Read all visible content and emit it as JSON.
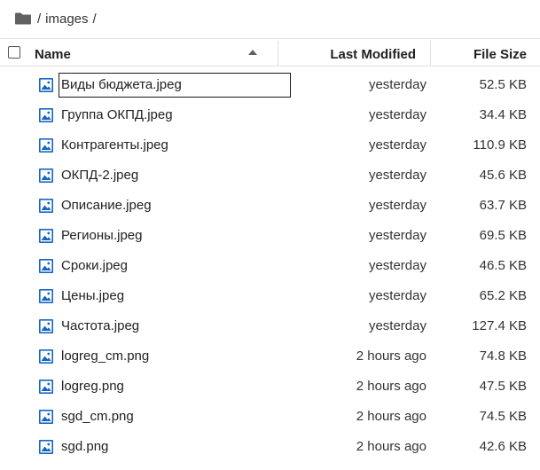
{
  "breadcrumb": {
    "folder_icon": "folder-icon",
    "segments": [
      "/",
      "images",
      "/"
    ]
  },
  "header": {
    "name_label": "Name",
    "modified_label": "Last Modified",
    "size_label": "File Size",
    "sort_icon": "sort-ascending-icon"
  },
  "files": [
    {
      "name": "Виды бюджета.jpeg",
      "modified": "yesterday",
      "size": "52.5 KB",
      "icon": "image-file-icon",
      "selected": true
    },
    {
      "name": "Группа ОКПД.jpeg",
      "modified": "yesterday",
      "size": "34.4 KB",
      "icon": "image-file-icon"
    },
    {
      "name": "Контрагенты.jpeg",
      "modified": "yesterday",
      "size": "110.9 KB",
      "icon": "image-file-icon"
    },
    {
      "name": "ОКПД-2.jpeg",
      "modified": "yesterday",
      "size": "45.6 KB",
      "icon": "image-file-icon"
    },
    {
      "name": "Описание.jpeg",
      "modified": "yesterday",
      "size": "63.7 KB",
      "icon": "image-file-icon"
    },
    {
      "name": "Регионы.jpeg",
      "modified": "yesterday",
      "size": "69.5 KB",
      "icon": "image-file-icon"
    },
    {
      "name": "Сроки.jpeg",
      "modified": "yesterday",
      "size": "46.5 KB",
      "icon": "image-file-icon"
    },
    {
      "name": "Цены.jpeg",
      "modified": "yesterday",
      "size": "65.2 KB",
      "icon": "image-file-icon"
    },
    {
      "name": "Частота.jpeg",
      "modified": "yesterday",
      "size": "127.4 KB",
      "icon": "image-file-icon"
    },
    {
      "name": "logreg_cm.png",
      "modified": "2 hours ago",
      "size": "74.8 KB",
      "icon": "image-file-icon"
    },
    {
      "name": "logreg.png",
      "modified": "2 hours ago",
      "size": "47.5 KB",
      "icon": "image-file-icon"
    },
    {
      "name": "sgd_cm.png",
      "modified": "2 hours ago",
      "size": "74.5 KB",
      "icon": "image-file-icon"
    },
    {
      "name": "sgd.png",
      "modified": "2 hours ago",
      "size": "42.6 KB",
      "icon": "image-file-icon"
    }
  ],
  "colors": {
    "icon_blue": "#1565c0",
    "border": "#e0e0e0"
  }
}
